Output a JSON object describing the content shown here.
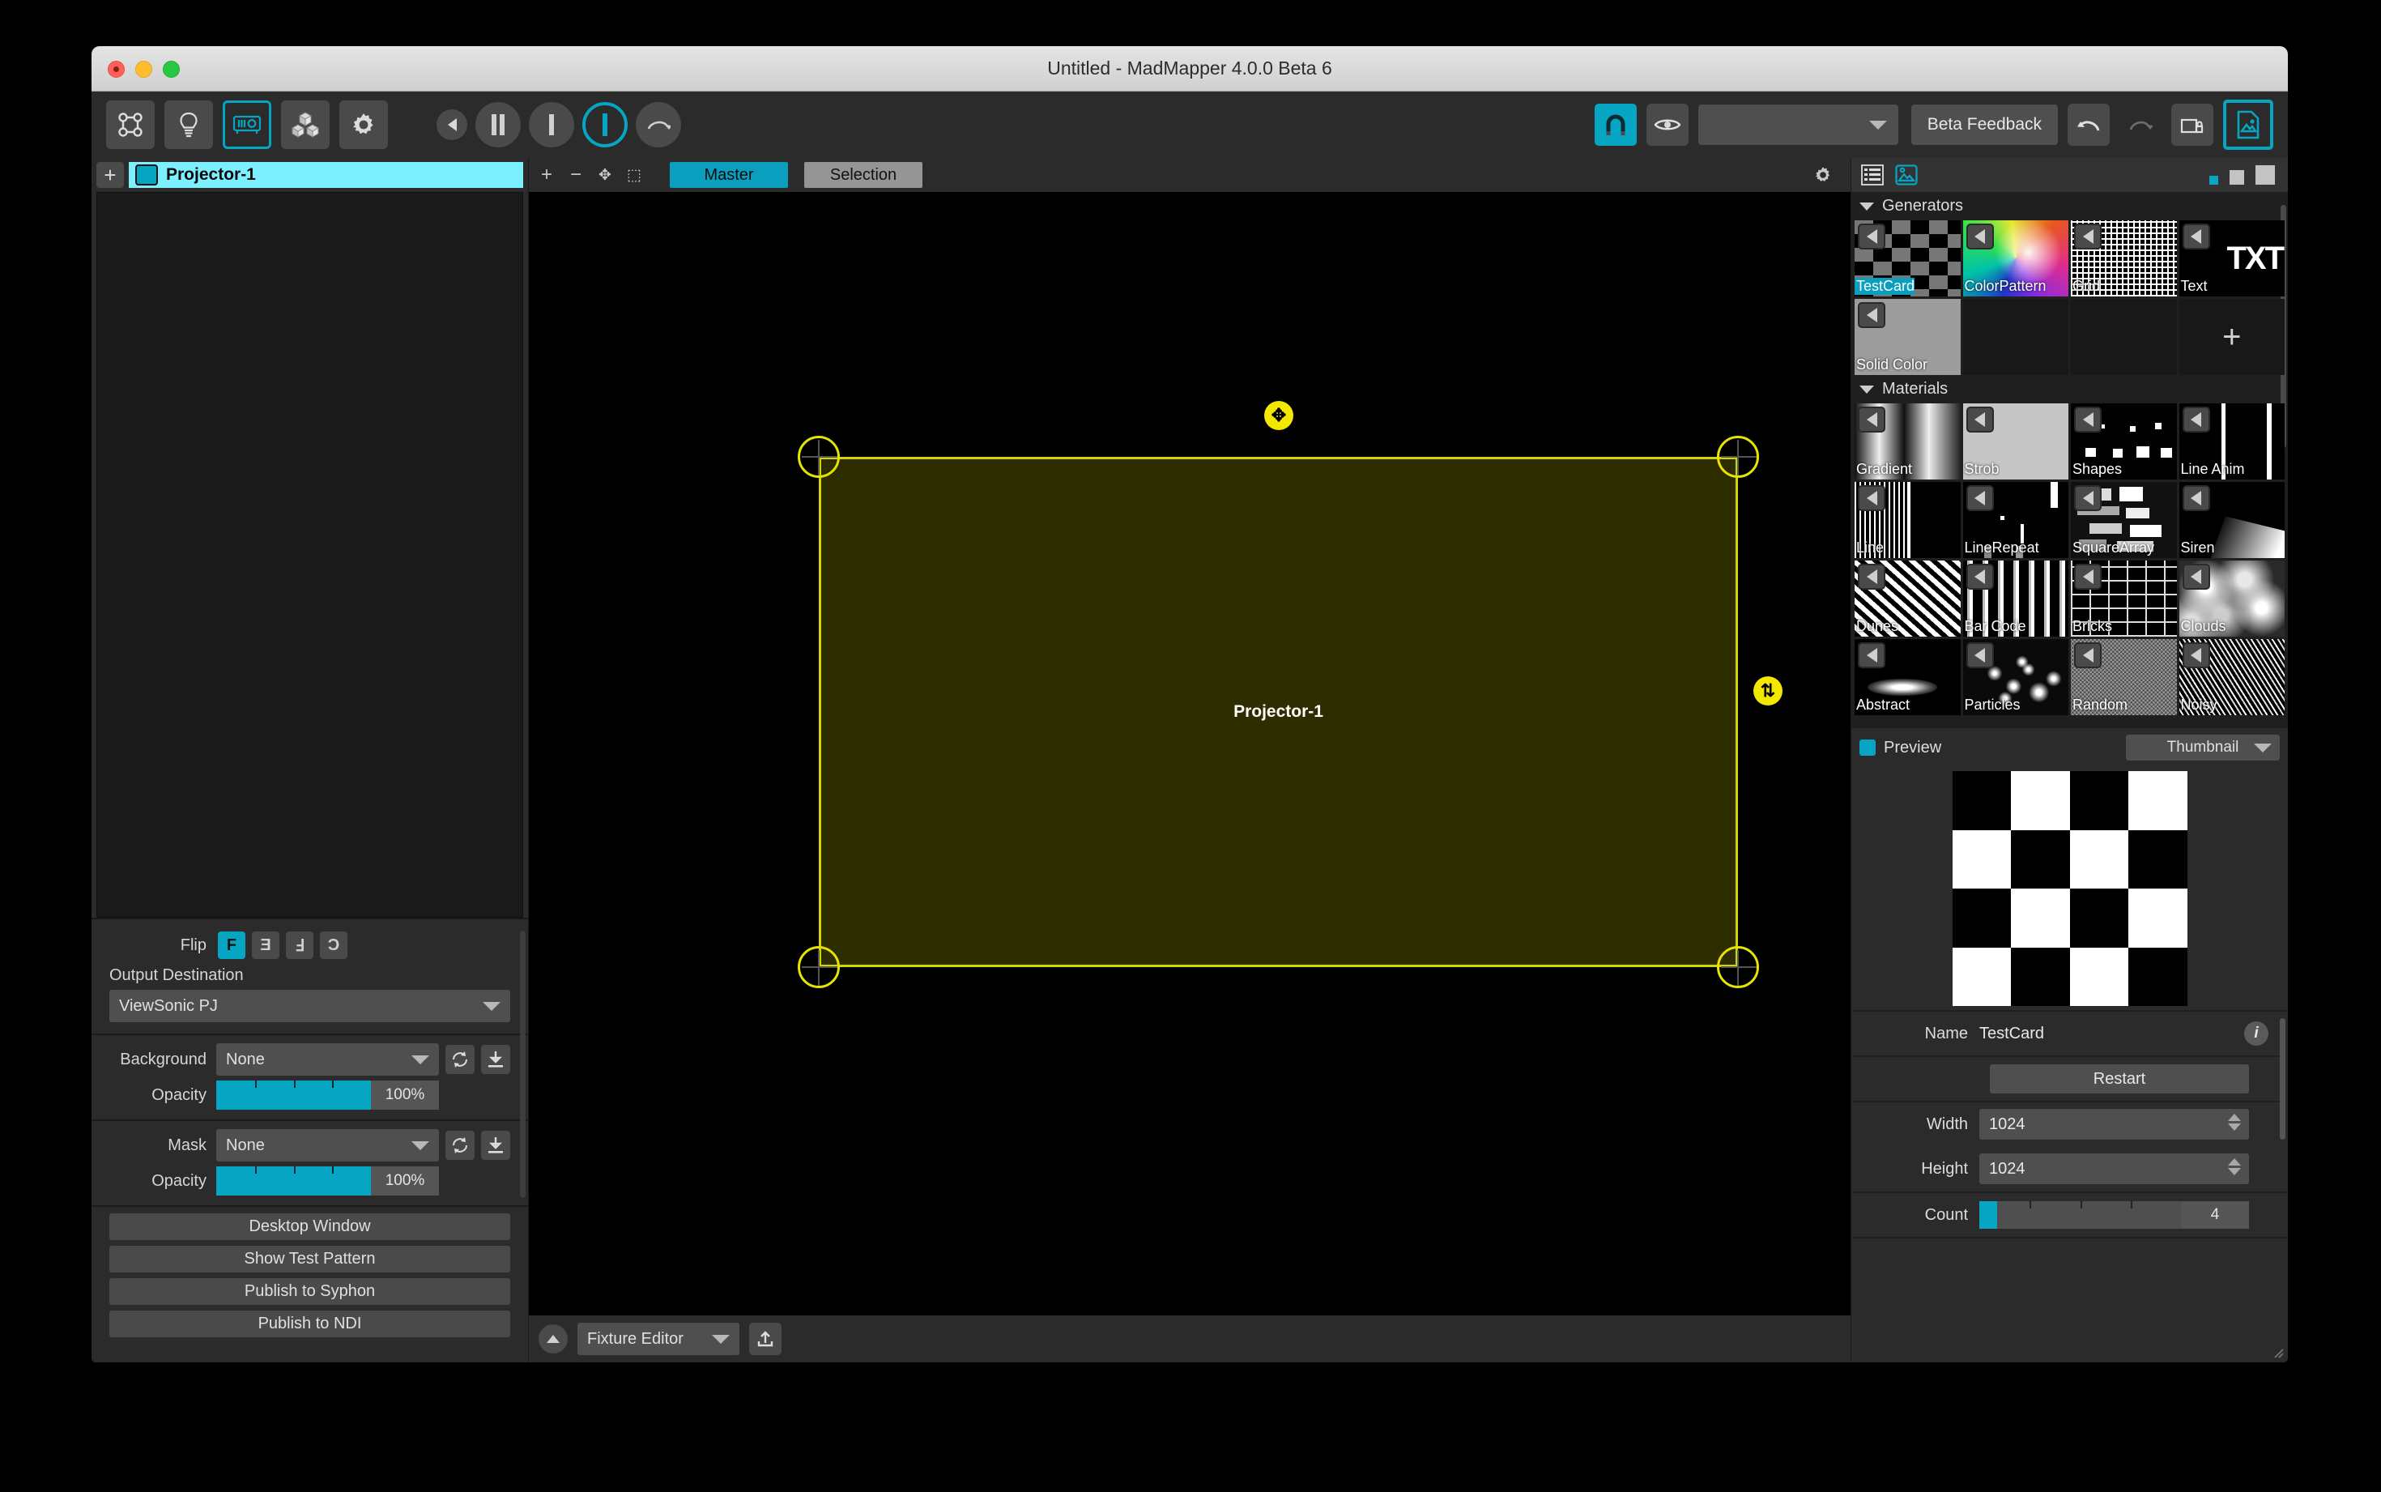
{
  "window": {
    "title": "Untitled - MadMapper 4.0.0 Beta 6",
    "traffic": {
      "close": "close-button",
      "minimize": "minimize-button",
      "zoom": "zoom-button"
    }
  },
  "toolbar": {
    "mode_icons": [
      {
        "name": "surfaces-icon",
        "active": false
      },
      {
        "name": "lights-icon",
        "active": false
      },
      {
        "name": "projector-icon",
        "active": true
      },
      {
        "name": "modules-icon",
        "active": false
      },
      {
        "name": "settings-gear-icon",
        "active": false
      }
    ],
    "transport": [
      {
        "name": "previous-button",
        "glyph": "◀"
      },
      {
        "name": "pause-button",
        "glyph": "▐▌"
      },
      {
        "name": "stop-bar-button",
        "glyph": "▍"
      },
      {
        "name": "play-cue-button",
        "glyph": "▍",
        "active": true
      },
      {
        "name": "redo-curve-button",
        "glyph": "↷"
      }
    ],
    "snap_label": "snap-magnet",
    "eye_label": "visibility-eye",
    "cue_dropdown_value": "",
    "beta_feedback_label": "Beta Feedback",
    "undo_label": "undo",
    "redo_label": "redo",
    "window_lock_label": "lock-output-window",
    "media_browser_label": "media-browser"
  },
  "left_panel": {
    "add_label": "+",
    "layers": [
      {
        "name": "Projector-1",
        "color": "#06a5c4",
        "selected": true
      }
    ],
    "properties": {
      "flip_label": "Flip",
      "flip_options": [
        {
          "glyph": "F",
          "active": true
        },
        {
          "glyph": "Ǝ",
          "active": false
        },
        {
          "glyph": "Ⅎ",
          "active": false
        },
        {
          "glyph": "Ɔ",
          "active": false
        }
      ],
      "output_destination_label": "Output Destination",
      "output_destination_value": "ViewSonic PJ",
      "background_label": "Background",
      "background_value": "None",
      "background_opacity_label": "Opacity",
      "background_opacity_value": "100%",
      "mask_label": "Mask",
      "mask_value": "None",
      "mask_opacity_label": "Opacity",
      "mask_opacity_value": "100%",
      "actions": [
        "Desktop Window",
        "Show Test Pattern",
        "Publish to Syphon",
        "Publish to NDI"
      ]
    }
  },
  "canvas": {
    "tools": [
      {
        "name": "add-surface-icon",
        "glyph": "+"
      },
      {
        "name": "remove-surface-icon",
        "glyph": "−"
      },
      {
        "name": "fit-surface-icon",
        "glyph": "✥"
      },
      {
        "name": "select-region-icon",
        "glyph": "⬚"
      }
    ],
    "tabs": [
      {
        "label": "Master",
        "active": true
      },
      {
        "label": "Selection",
        "active": false
      }
    ],
    "settings_icon": "canvas-settings-gear",
    "surface": {
      "label": "Projector-1",
      "outline_color": "#d4d400",
      "fill_color": "rgba(160,160,0,0.28)",
      "handle_color": "#f2e800",
      "move_handle_glyph": "✥",
      "resize_handle_glyph": "⇅"
    },
    "footer": {
      "collapse_icon": "collapse-chevron-up",
      "editor_value": "Fixture Editor",
      "export_icon": "export-upload"
    }
  },
  "right_panel": {
    "header": {
      "list_view_icon": "list-view",
      "thumb_view_icon": "thumbnail-view",
      "size_small": "size-small",
      "size_medium": "size-medium",
      "size_large": "size-large"
    },
    "generators": {
      "title": "Generators",
      "items": [
        {
          "label": "TestCard",
          "thumb": "checker",
          "selected": true
        },
        {
          "label": "ColorPattern",
          "thumb": "colorwheel",
          "selected": false
        },
        {
          "label": "Grid",
          "thumb": "grid",
          "selected": false
        },
        {
          "label": "Text",
          "thumb": "text",
          "selected": false
        },
        {
          "label": "Solid Color",
          "thumb": "solid",
          "selected": false
        }
      ],
      "add_label": "+"
    },
    "materials": {
      "title": "Materials",
      "items": [
        {
          "label": "Gradient",
          "thumb": "gradient"
        },
        {
          "label": "Strob",
          "thumb": "strob"
        },
        {
          "label": "Shapes",
          "thumb": "shapes"
        },
        {
          "label": "Line Anim",
          "thumb": "lineanim"
        },
        {
          "label": "Line",
          "thumb": "line"
        },
        {
          "label": "LineRepeat",
          "thumb": "linerepeat"
        },
        {
          "label": "SquareArray",
          "thumb": "squarearray"
        },
        {
          "label": "Siren",
          "thumb": "siren"
        },
        {
          "label": "Dunes",
          "thumb": "dunes"
        },
        {
          "label": "Bar Code",
          "thumb": "barcode"
        },
        {
          "label": "Bricks",
          "thumb": "bricks"
        },
        {
          "label": "Clouds",
          "thumb": "clouds"
        },
        {
          "label": "Abstract",
          "thumb": "abstract"
        },
        {
          "label": "Particles",
          "thumb": "particles"
        },
        {
          "label": "Random",
          "thumb": "random"
        },
        {
          "label": "Noisy",
          "thumb": "noisy"
        }
      ]
    },
    "preview": {
      "title": "Preview",
      "mode_value": "Thumbnail",
      "swatch_color": "#06a5c4"
    },
    "properties": {
      "name_label": "Name",
      "name_value": "TestCard",
      "info_icon": "info",
      "restart_label": "Restart",
      "width_label": "Width",
      "width_value": "1024",
      "height_label": "Height",
      "height_value": "1024",
      "count_label": "Count",
      "count_value": "4"
    }
  }
}
